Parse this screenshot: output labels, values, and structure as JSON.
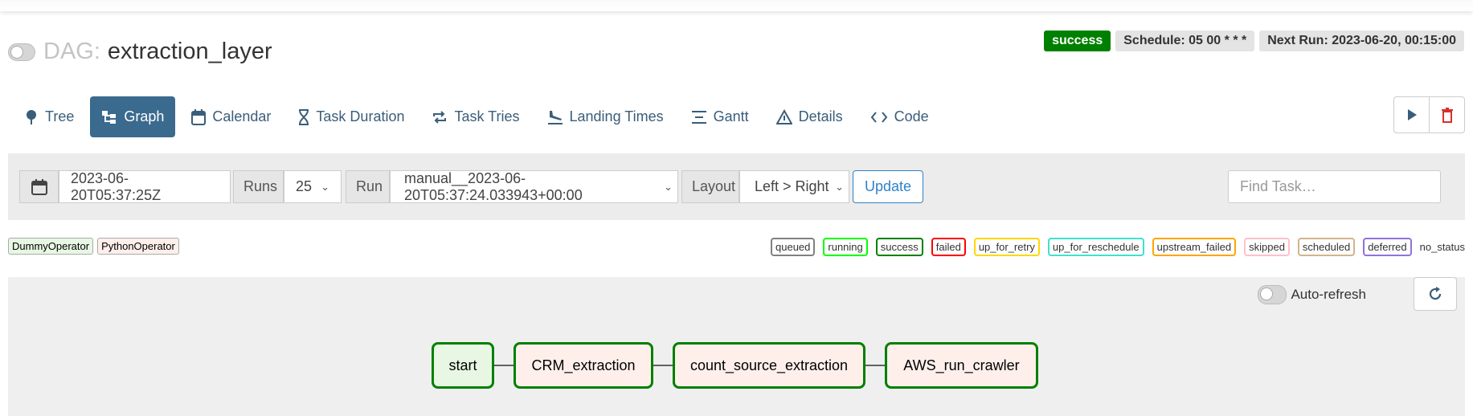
{
  "dag": {
    "prefix": "DAG:",
    "name": "extraction_layer"
  },
  "badges": {
    "status": "success",
    "schedule": "Schedule: 05 00 * * *",
    "next_run": "Next Run: 2023-06-20, 00:15:00",
    "status_color": "#008000"
  },
  "tabs": [
    {
      "label": "Tree",
      "icon": "pin-icon"
    },
    {
      "label": "Graph",
      "icon": "graph-icon",
      "active": true
    },
    {
      "label": "Calendar",
      "icon": "calendar-icon"
    },
    {
      "label": "Task Duration",
      "icon": "hourglass-icon"
    },
    {
      "label": "Task Tries",
      "icon": "repeat-icon"
    },
    {
      "label": "Landing Times",
      "icon": "plane-landing-icon"
    },
    {
      "label": "Gantt",
      "icon": "gantt-icon"
    },
    {
      "label": "Details",
      "icon": "warning-triangle-icon"
    },
    {
      "label": "Code",
      "icon": "code-icon"
    }
  ],
  "controls": {
    "date": "2023-06-20T05:37:25Z",
    "runs_label": "Runs",
    "runs_value": "25",
    "run_label": "Run",
    "run_value": "manual__2023-06-20T05:37:24.033943+00:00",
    "layout_label": "Layout",
    "layout_value": "Left > Right",
    "update": "Update",
    "find_placeholder": "Find Task…"
  },
  "operators": [
    {
      "label": "DummyOperator",
      "color": "#e8f7e4"
    },
    {
      "label": "PythonOperator",
      "color": "#ffefeb"
    }
  ],
  "states": [
    {
      "label": "queued",
      "color": "#808080"
    },
    {
      "label": "running",
      "color": "#00ff00"
    },
    {
      "label": "success",
      "color": "#008000"
    },
    {
      "label": "failed",
      "color": "#ff0000"
    },
    {
      "label": "up_for_retry",
      "color": "#ffd700"
    },
    {
      "label": "up_for_reschedule",
      "color": "#40e0d0"
    },
    {
      "label": "upstream_failed",
      "color": "#ffa500"
    },
    {
      "label": "skipped",
      "color": "#ffc0cb"
    },
    {
      "label": "scheduled",
      "color": "#d2b48c"
    },
    {
      "label": "deferred",
      "color": "#9370db"
    }
  ],
  "no_status": "no_status",
  "auto_refresh": "Auto-refresh",
  "graph": {
    "nodes": [
      {
        "label": "start",
        "operator": "DummyOperator",
        "state": "success"
      },
      {
        "label": "CRM_extraction",
        "operator": "PythonOperator",
        "state": "success"
      },
      {
        "label": "count_source_extraction",
        "operator": "PythonOperator",
        "state": "success"
      },
      {
        "label": "AWS_run_crawler",
        "operator": "PythonOperator",
        "state": "success"
      }
    ]
  }
}
